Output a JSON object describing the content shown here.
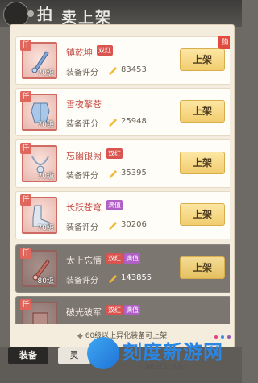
{
  "header": {
    "title_char": "拍",
    "subtitle": "卖上架"
  },
  "items": [
    {
      "name": "镇乾坤",
      "tag": "双红",
      "tag_color": "#d9534f",
      "grade": "仟",
      "level": "70级",
      "score_label": "装备评分",
      "score": "83453",
      "button": "上架",
      "corner": "购"
    },
    {
      "name": "雪夜擎苍",
      "tag": "",
      "tag_color": "",
      "grade": "仟",
      "level": "70级",
      "score_label": "装备评分",
      "score": "25948",
      "button": "上架",
      "corner": ""
    },
    {
      "name": "忘幽银阙",
      "tag": "双红",
      "tag_color": "#d9534f",
      "grade": "仟",
      "level": "70级",
      "score_label": "装备评分",
      "score": "35395",
      "button": "上架",
      "corner": ""
    },
    {
      "name": "长跃苍穹",
      "tag": "满值",
      "tag_color": "#d9534f",
      "grade": "仟",
      "level": "70级",
      "score_label": "装备评分",
      "score": "30206",
      "button": "上架",
      "corner": ""
    },
    {
      "name": "太上忘情",
      "tag": "双红",
      "tag2": "满值",
      "tag_color": "#d9534f",
      "grade": "仟",
      "level": "80级",
      "score_label": "装备评分",
      "score": "143855",
      "button": "上架",
      "corner": ""
    },
    {
      "name": "破光破军",
      "tag": "双红",
      "tag2": "满值",
      "tag_color": "#d9534f",
      "grade": "仟",
      "level": "",
      "score_label": "",
      "score": "",
      "button": "",
      "corner": ""
    }
  ],
  "footer_note": "60级以上异化装备可上架",
  "tabs": [
    {
      "label": "装备"
    },
    {
      "label": "灵"
    }
  ],
  "watermark": {
    "text": "刻度新游网",
    "url": "AKEDU.NET"
  }
}
